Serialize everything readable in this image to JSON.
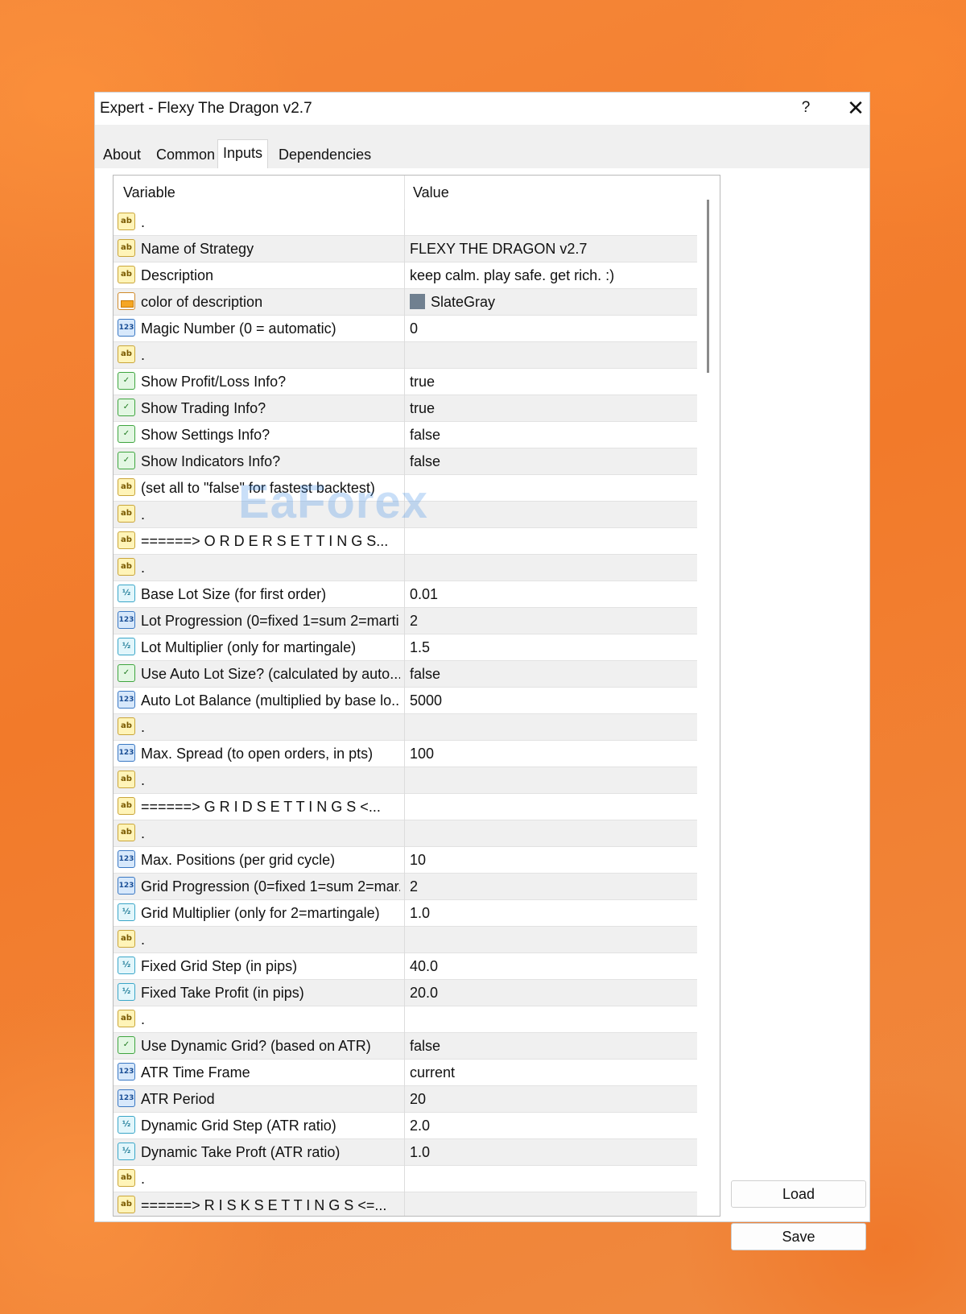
{
  "window": {
    "title": "Expert - Flexy The Dragon v2.7",
    "help_label": "?",
    "close_label": "✕"
  },
  "tabs": [
    {
      "label": "About",
      "active": false
    },
    {
      "label": "Common",
      "active": false
    },
    {
      "label": "Inputs",
      "active": true
    },
    {
      "label": "Dependencies",
      "active": false
    }
  ],
  "grid": {
    "columns": [
      "Variable",
      "Value"
    ],
    "rows": [
      {
        "type": "ab",
        "variable": ".",
        "value": ""
      },
      {
        "type": "ab",
        "variable": "Name of Strategy",
        "value": "FLEXY THE DRAGON v2.7"
      },
      {
        "type": "ab",
        "variable": "Description",
        "value": "keep calm. play safe. get rich. :)"
      },
      {
        "type": "color",
        "variable": "color of description",
        "value": "SlateGray"
      },
      {
        "type": "n123",
        "variable": "Magic Number (0 = automatic)",
        "value": "0"
      },
      {
        "type": "ab",
        "variable": ".",
        "value": ""
      },
      {
        "type": "bool",
        "variable": "Show Profit/Loss Info?",
        "value": "true"
      },
      {
        "type": "bool",
        "variable": "Show Trading Info?",
        "value": "true"
      },
      {
        "type": "bool",
        "variable": "Show Settings Info?",
        "value": "false"
      },
      {
        "type": "bool",
        "variable": "Show Indicators Info?",
        "value": "false"
      },
      {
        "type": "ab",
        "variable": "(set all to \"false\" for fastest backtest)",
        "value": ""
      },
      {
        "type": "ab",
        "variable": ".",
        "value": ""
      },
      {
        "type": "ab",
        "variable": "======> O R D E R   S E T T I N G S...",
        "value": ""
      },
      {
        "type": "ab",
        "variable": ".",
        "value": ""
      },
      {
        "type": "frac",
        "variable": "Base Lot Size (for first order)",
        "value": "0.01"
      },
      {
        "type": "n123",
        "variable": "Lot Progression (0=fixed 1=sum 2=marti...",
        "value": "2"
      },
      {
        "type": "frac",
        "variable": "Lot Multiplier (only for martingale)",
        "value": "1.5"
      },
      {
        "type": "bool",
        "variable": "Use Auto Lot Size? (calculated by auto...",
        "value": "false"
      },
      {
        "type": "n123",
        "variable": "Auto Lot Balance (multiplied by base lo...",
        "value": "5000"
      },
      {
        "type": "ab",
        "variable": ".",
        "value": ""
      },
      {
        "type": "n123",
        "variable": "Max. Spread (to open orders, in pts)",
        "value": "100"
      },
      {
        "type": "ab",
        "variable": ".",
        "value": ""
      },
      {
        "type": "ab",
        "variable": "======> G R I D   S E T T I N G S  <...",
        "value": ""
      },
      {
        "type": "ab",
        "variable": ".",
        "value": ""
      },
      {
        "type": "n123",
        "variable": "Max. Positions (per grid cycle)",
        "value": "10"
      },
      {
        "type": "n123",
        "variable": "Grid Progression (0=fixed 1=sum 2=mar...",
        "value": "2"
      },
      {
        "type": "frac",
        "variable": "Grid Multiplier (only for 2=martingale)",
        "value": "1.0"
      },
      {
        "type": "ab",
        "variable": ".",
        "value": ""
      },
      {
        "type": "frac",
        "variable": "Fixed Grid Step (in pips)",
        "value": "40.0"
      },
      {
        "type": "frac",
        "variable": "Fixed Take Profit (in pips)",
        "value": "20.0"
      },
      {
        "type": "ab",
        "variable": ".",
        "value": ""
      },
      {
        "type": "bool",
        "variable": "Use Dynamic Grid? (based on ATR)",
        "value": "false"
      },
      {
        "type": "n123",
        "variable": "ATR Time Frame",
        "value": "current"
      },
      {
        "type": "n123",
        "variable": "ATR Period",
        "value": "20"
      },
      {
        "type": "frac",
        "variable": "Dynamic Grid Step (ATR ratio)",
        "value": "2.0"
      },
      {
        "type": "frac",
        "variable": "Dynamic Take Proft (ATR ratio)",
        "value": "1.0"
      },
      {
        "type": "ab",
        "variable": ".",
        "value": ""
      },
      {
        "type": "ab",
        "variable": "======> R I S K   S E T T I N G S  <=...",
        "value": ""
      }
    ]
  },
  "buttons": {
    "load_label": "Load",
    "save_label": "Save"
  },
  "icon_names": {
    "ab": "string-type-icon",
    "n123": "integer-type-icon",
    "frac": "double-type-icon",
    "bool": "boolean-type-icon",
    "color": "color-type-icon"
  },
  "icon_glyphs": {
    "ab": "ab",
    "n123": "123",
    "frac": "½",
    "bool": "✓",
    "color": ""
  },
  "watermark": "EaForex"
}
